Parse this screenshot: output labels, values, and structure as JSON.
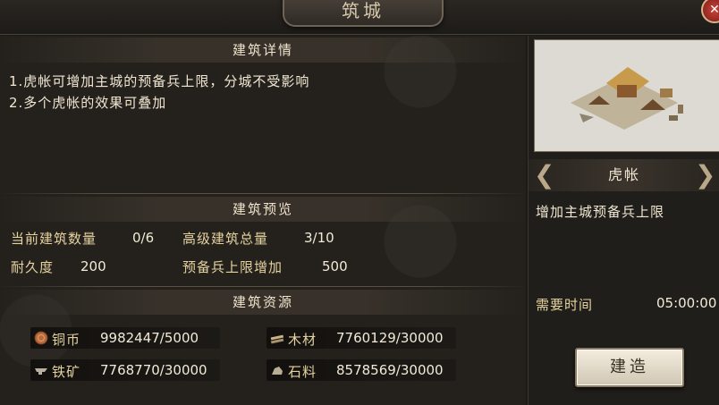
{
  "window": {
    "title": "筑城"
  },
  "details": {
    "heading": "建筑详情",
    "lines": [
      "1.虎帐可增加主城的预备兵上限，分城不受影响",
      "2.多个虎帐的效果可叠加"
    ]
  },
  "preview": {
    "heading": "建筑预览",
    "current_count_label": "当前建筑数量",
    "current_count_value": "0/6",
    "advanced_total_label": "高级建筑总量",
    "advanced_total_value": "3/10",
    "durability_label": "耐久度",
    "durability_value": "200",
    "reserve_increase_label": "预备兵上限增加",
    "reserve_increase_value": "500"
  },
  "resources": {
    "heading": "建筑资源",
    "items": [
      {
        "icon": "copper-coin-icon",
        "label": "铜币",
        "value": "9982447/5000"
      },
      {
        "icon": "wood-icon",
        "label": "木材",
        "value": "7760129/30000"
      },
      {
        "icon": "iron-ore-icon",
        "label": "铁矿",
        "value": "7768770/30000"
      },
      {
        "icon": "stone-icon",
        "label": "石料",
        "value": "8578569/30000"
      }
    ]
  },
  "building": {
    "name": "虎帐",
    "effect": "增加主城预备兵上限",
    "time_label": "需要时间",
    "time_value": "05:00:00",
    "build_label": "建造"
  },
  "colors": {
    "accent_gold": "#e5d29f",
    "text": "#f0e6d2",
    "panel": "#24211d"
  }
}
